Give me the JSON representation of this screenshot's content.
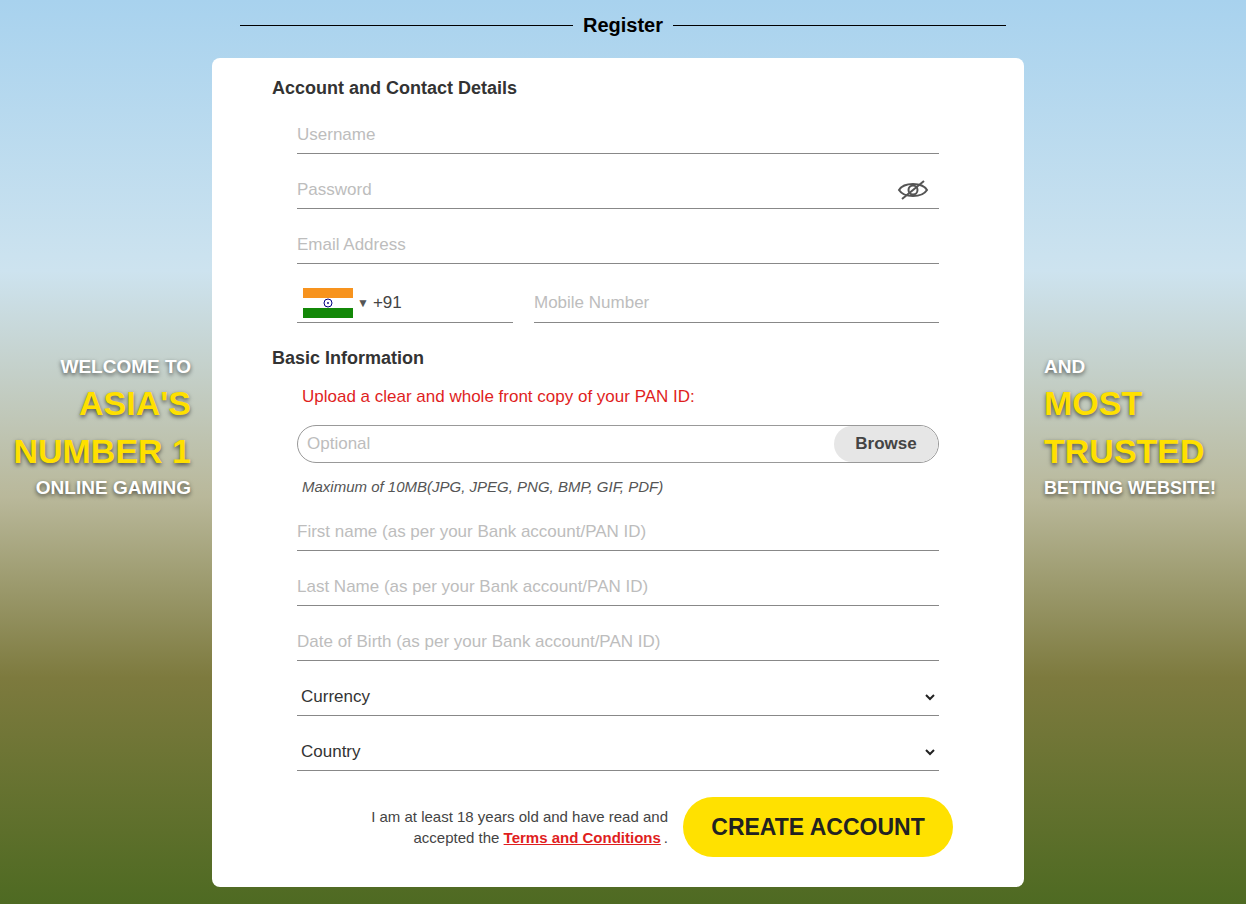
{
  "page": {
    "title": "Register"
  },
  "banner_left": [
    "WELCOME TO",
    "ASIA'S",
    "NUMBER 1",
    "ONLINE GAMING"
  ],
  "banner_right": [
    "AND",
    "MOST",
    "TRUSTED",
    "BETTING WEBSITE!"
  ],
  "account": {
    "heading": "Account and Contact Details",
    "username": {
      "placeholder": "Username"
    },
    "password": {
      "placeholder": "Password"
    },
    "email": {
      "placeholder": "Email Address"
    },
    "phone": {
      "caret": "▼",
      "code": "+91",
      "placeholder": "Mobile Number"
    }
  },
  "basic": {
    "heading": "Basic Information",
    "upload": {
      "label": "Upload a clear and whole front copy of your PAN ID:",
      "placeholder": "Optional",
      "button": "Browse",
      "note": "Maximum of 10MB(JPG, JPEG, PNG, BMP, GIF, PDF)"
    },
    "fields": [
      {
        "placeholder": "First name (as per your Bank account/PAN ID)"
      },
      {
        "placeholder": "Last Name (as per your Bank account/PAN ID)"
      },
      {
        "placeholder": "Date of Birth (as per your Bank account/PAN ID)"
      }
    ],
    "selects": [
      {
        "label": "Currency"
      },
      {
        "label": "Country"
      }
    ]
  },
  "footer": {
    "consent": "I am at least 18 years old and have read and accepted the",
    "terms_link": "Terms and Conditions",
    "period": ".",
    "button": "CREATE ACCOUNT"
  }
}
